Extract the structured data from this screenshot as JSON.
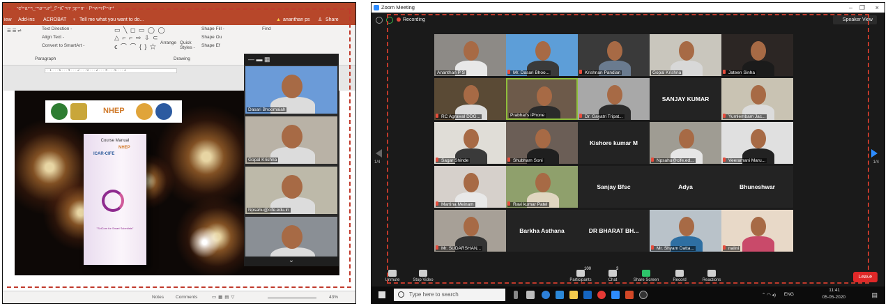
{
  "ppt": {
    "title": "release_manual_SciCom.ppsm - PowerPoint",
    "menu": [
      "iew",
      "Add-ins",
      "ACROBAT",
      "Tell me what you want to do..."
    ],
    "user": "ananthan ps",
    "share": "Share",
    "ribbon": {
      "text_direction": "Text Direction -",
      "align_text": "Align Text -",
      "convert": "Convert to SmartArt -",
      "paragraph": "Paragraph",
      "arrange": "Arrange",
      "quick_styles": "Quick Styles -",
      "shape_fill": "Shape Fill -",
      "shape_outline": "Shape Ou",
      "shape_effects": "Shape Ef",
      "drawing": "Drawing",
      "find": "Find"
    },
    "ruler": "· · 1 · · · 6 · · · 4 · · · 2 · · · 0 · · · 2 · · · 4 · · · 6 · · · 1",
    "slide": {
      "logo_text": "NHEP",
      "book_course": "Course Manual",
      "book_icar": "ICAR-CIFE",
      "book_nhep": "NHEP",
      "book_sub": "\"SciCom for Smart Scientists\""
    },
    "gallery": [
      {
        "name": "Dasari Bhoomaiah",
        "bg": "#6b9bd8"
      },
      {
        "name": "Gopal Krishna",
        "bg": "#b9b2a6"
      },
      {
        "name": "Npsahu@cife.edu.in",
        "bg": "#bdb9a9"
      },
      {
        "name": "",
        "bg": "#8a8f95"
      }
    ],
    "status": {
      "notes": "Notes",
      "comments": "Comments",
      "zoom": "43%"
    }
  },
  "zoom": {
    "title": "Zoom Meeting",
    "recording": "Recording",
    "speaker_view": "Speaker View",
    "page_left": "1/4",
    "page_right": "1/4",
    "tiles": [
      {
        "name": "Ananthan P S",
        "kind": "video",
        "bg": "#8d8a86",
        "shirt": "#e8e8e8",
        "mic": false
      },
      {
        "name": "Mr. Dasari Bhoo...",
        "kind": "video",
        "bg": "#5d9ed8",
        "shirt": "#3a3a3a",
        "mic": true
      },
      {
        "name": "Krishnan Pandian",
        "kind": "video",
        "bg": "#3a3a3a",
        "shirt": "#6a7b8f",
        "mic": true
      },
      {
        "name": "Gopal Krishna",
        "kind": "video",
        "bg": "#c9c6bd",
        "shirt": "#d8d8d8",
        "mic": false
      },
      {
        "name": "Jateen Sinha",
        "kind": "video",
        "bg": "#2c2624",
        "shirt": "#1b1b1b",
        "mic": true
      },
      {
        "name": "RC Agrawal DDG...",
        "kind": "video",
        "bg": "#5a4a35",
        "shirt": "#dcdcdc",
        "mic": true
      },
      {
        "name": "Prabhat's iPhone",
        "kind": "video",
        "bg": "#6d5a4a",
        "shirt": "#2a2a2a",
        "mic": false,
        "active": true
      },
      {
        "name": "Dr. Gayatri Tripat...",
        "kind": "video",
        "bg": "#a8a8a8",
        "shirt": "#2b2b2b",
        "mic": true
      },
      {
        "name": "SANJAY KUMAR",
        "kind": "text",
        "mic": false
      },
      {
        "name": "Yumlembam Jac...",
        "kind": "video",
        "bg": "#c9c3b3",
        "shirt": "#dcdcdc",
        "mic": true
      },
      {
        "name": "Sagar Shinde",
        "kind": "video",
        "bg": "#e0ddd7",
        "shirt": "#3a3a3a",
        "mic": true
      },
      {
        "name": "Shubham Soni",
        "kind": "video",
        "bg": "#6b5e56",
        "shirt": "#1f1f1f",
        "mic": true
      },
      {
        "name": "Kishore kumar M",
        "kind": "text",
        "mic": false
      },
      {
        "name": "Npsahu@cife.ed...",
        "kind": "video",
        "bg": "#9f9c93",
        "shirt": "#e6e6e6",
        "mic": true
      },
      {
        "name": "Veeramani Maru...",
        "kind": "video",
        "bg": "#e0e0e0",
        "shirt": "#222",
        "mic": true
      },
      {
        "name": "Martina Meinam",
        "kind": "video",
        "bg": "#d6d0cb",
        "shirt": "#e8e8e8",
        "mic": true
      },
      {
        "name": "Ravi kumar Patel",
        "kind": "video",
        "bg": "#8fa06c",
        "shirt": "#e0d6c0",
        "mic": true
      },
      {
        "name": "Sanjay Bfsc",
        "kind": "text",
        "mic": false
      },
      {
        "name": "Adya",
        "kind": "text",
        "mic": false
      },
      {
        "name": "Bhuneshwar",
        "kind": "text",
        "mic": false
      },
      {
        "name": "Mr. SUDARSHAN...",
        "kind": "video",
        "bg": "#a7a097",
        "shirt": "#333",
        "mic": true
      },
      {
        "name": "Barkha Asthana",
        "kind": "text",
        "mic": false
      },
      {
        "name": "DR BHARAT BH...",
        "kind": "text",
        "mic": false
      },
      {
        "name": "Mr. Shyam Datta...",
        "kind": "video",
        "bg": "#b9c2c9",
        "shirt": "#2e6fa2",
        "mic": true
      },
      {
        "name": "nalini",
        "kind": "video",
        "bg": "#e8d9c8",
        "shirt": "#c94a6a",
        "mic": true
      }
    ],
    "controls": [
      {
        "label": "Unmute",
        "icon": "microphone-icon"
      },
      {
        "label": "Stop Video",
        "icon": "camera-icon"
      },
      {
        "label": "Participants",
        "icon": "participants-icon",
        "badge": "100"
      },
      {
        "label": "Chat",
        "icon": "chat-icon",
        "badge": "3"
      },
      {
        "label": "Share Screen",
        "icon": "share-screen-icon"
      },
      {
        "label": "Record",
        "icon": "record-icon"
      },
      {
        "label": "Reactions",
        "icon": "reactions-icon"
      }
    ],
    "leave": "Leave"
  },
  "taskbar": {
    "search_placeholder": "Type here to search",
    "lang": "ENG",
    "time": "11:41",
    "date": "05-05-2020"
  }
}
